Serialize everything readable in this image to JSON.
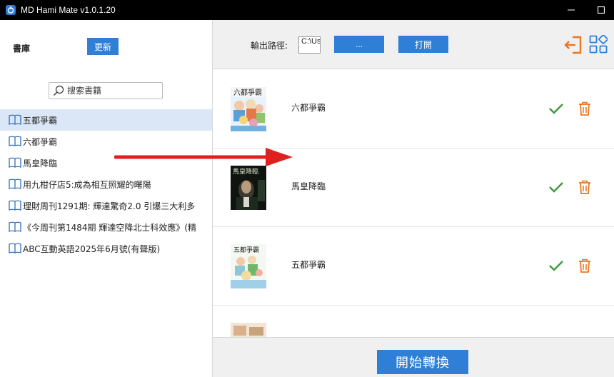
{
  "window": {
    "title": "MD Hami Mate v1.0.1.20"
  },
  "sidebar": {
    "library_label": "書庫",
    "update_button": "更新",
    "search_placeholder": "搜索書籍",
    "books": [
      {
        "title": "五都爭霸",
        "selected": true
      },
      {
        "title": "六都爭霸",
        "selected": false
      },
      {
        "title": "馬皇降臨",
        "selected": false
      },
      {
        "title": "用九柑仔店5:成為相互照耀的曙陽",
        "selected": false
      },
      {
        "title": "理財周刊1291期: 輝達驚奇2.0 引爆三大利多",
        "selected": false
      },
      {
        "title": "《今周刊第1484期 輝達空降北士科效應》(精",
        "selected": false
      },
      {
        "title": "ABC互動英語2025年6月號(有聲版)",
        "selected": false
      }
    ]
  },
  "toolbar": {
    "output_path_label": "輸出路徑:",
    "output_path_value": "C:\\Us",
    "browse_button": "...",
    "open_button": "打開"
  },
  "queue": [
    {
      "title": "六都爭霸",
      "status": "done"
    },
    {
      "title": "馬皇降臨",
      "status": "done"
    },
    {
      "title": "五都爭霸",
      "status": "done"
    }
  ],
  "footer": {
    "convert_button": "開始轉換"
  },
  "colors": {
    "accent": "#2f7fd6",
    "check": "#3a9a3a",
    "trash": "#e87722",
    "arrow": "#e02020",
    "selection": "#dbe7f7"
  }
}
